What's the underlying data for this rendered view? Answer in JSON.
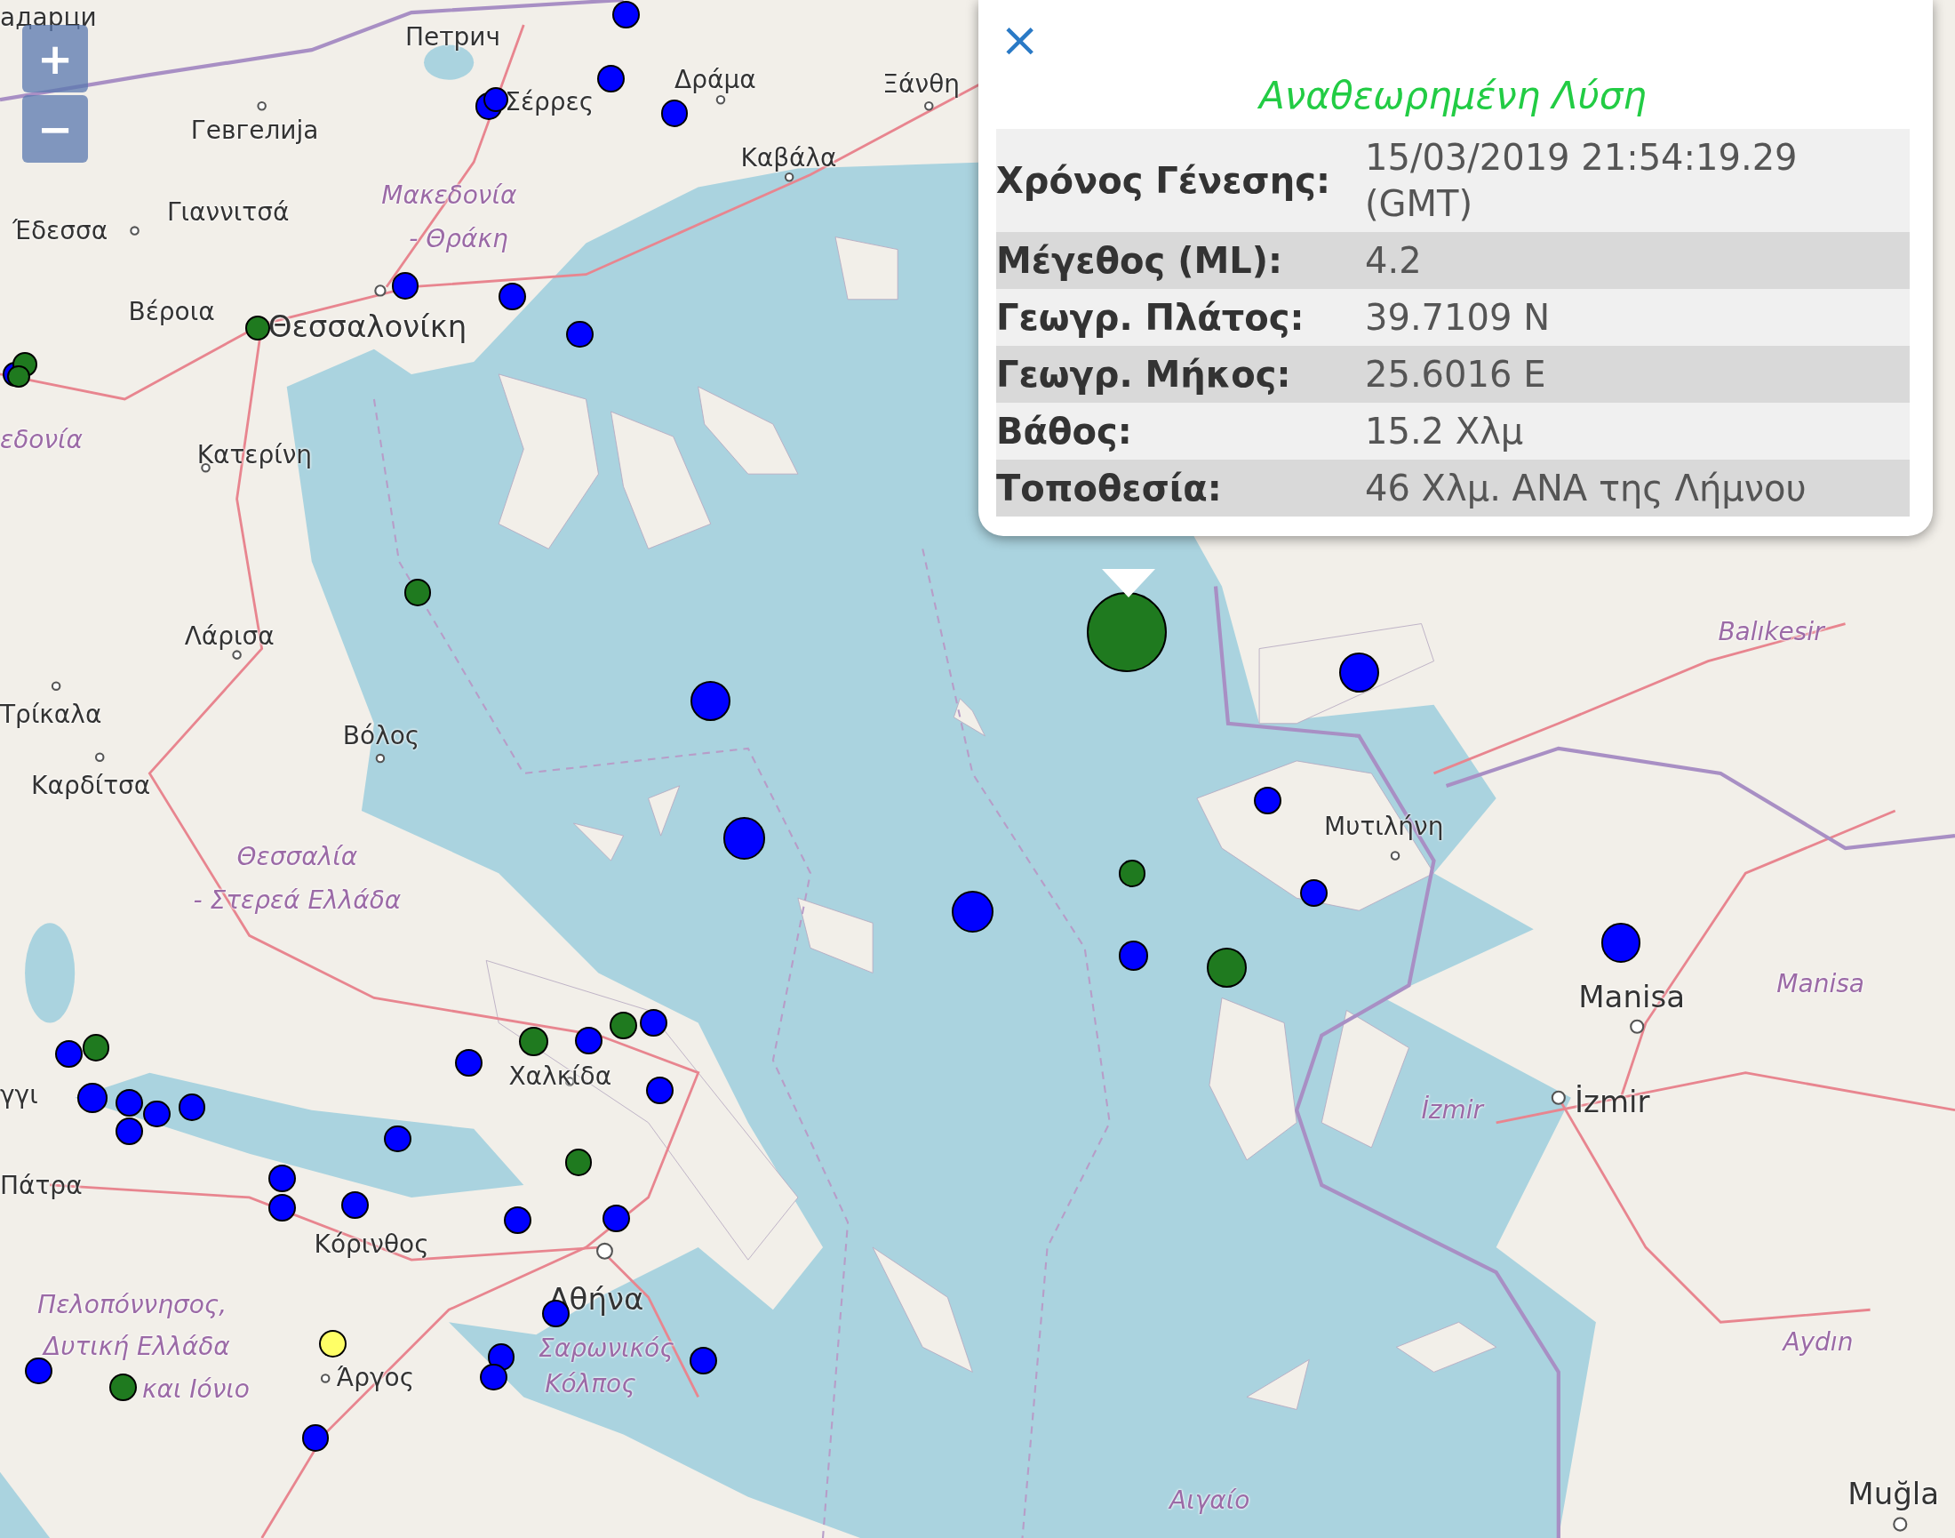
{
  "zoom_controls": [
    {
      "label": "+"
    },
    {
      "label": "−"
    }
  ],
  "map": {
    "labels": [
      {
        "text": "адарци",
        "kind": "city"
      },
      {
        "text": "Петрич",
        "kind": "city"
      },
      {
        "text": "Σέρρες",
        "kind": "city"
      },
      {
        "text": "Δράμα",
        "kind": "city"
      },
      {
        "text": "Ξάνθη",
        "kind": "city"
      },
      {
        "text": "Гевгелија",
        "kind": "city"
      },
      {
        "text": "Καβάλα",
        "kind": "city"
      },
      {
        "text": "Γιαννιτσά",
        "kind": "city"
      },
      {
        "text": "Μακεδονία",
        "kind": "region"
      },
      {
        "text": "- Θράκη",
        "kind": "region"
      },
      {
        "text": "Έδεσσα",
        "kind": "city"
      },
      {
        "text": "Βέροια",
        "kind": "city"
      },
      {
        "text": "Θεσσαλονίκη",
        "kind": "major"
      },
      {
        "text": "εδονία",
        "kind": "region"
      },
      {
        "text": "Κατερίνη",
        "kind": "city"
      },
      {
        "text": "Λάρισα",
        "kind": "city"
      },
      {
        "text": "Τρίκαλα",
        "kind": "city"
      },
      {
        "text": "Βόλος",
        "kind": "city"
      },
      {
        "text": "Καρδίτσα",
        "kind": "city"
      },
      {
        "text": "Θεσσαλία",
        "kind": "region"
      },
      {
        "text": "- Στερεά Ελλάδα",
        "kind": "region"
      },
      {
        "text": "Μυτιλήνη",
        "kind": "city"
      },
      {
        "text": "Balıkesir",
        "kind": "region"
      },
      {
        "text": "Manisa",
        "kind": "major"
      },
      {
        "text": "Manisa",
        "kind": "region"
      },
      {
        "text": "İzmir",
        "kind": "region"
      },
      {
        "text": "İzmir",
        "kind": "major"
      },
      {
        "text": "Aydın",
        "kind": "region"
      },
      {
        "text": "Muğla",
        "kind": "major"
      },
      {
        "text": "Αιγαίο",
        "kind": "region"
      },
      {
        "text": "γγι",
        "kind": "city"
      },
      {
        "text": "Χαλκίδα",
        "kind": "city"
      },
      {
        "text": "Πάτρα",
        "kind": "city"
      },
      {
        "text": "Κόρινθος",
        "kind": "city"
      },
      {
        "text": "Αθήνα",
        "kind": "major"
      },
      {
        "text": "Σαρωνικός",
        "kind": "region"
      },
      {
        "text": "Κόλπος",
        "kind": "region"
      },
      {
        "text": "Πελοπόννησος,",
        "kind": "region"
      },
      {
        "text": "Δυτική Ελλάδα",
        "kind": "region"
      },
      {
        "text": "και Ιόνιο",
        "kind": "region"
      },
      {
        "text": "Άργος",
        "kind": "city"
      }
    ],
    "markers": [
      {
        "color": "#0000ff"
      },
      {
        "color": "#0000ff"
      },
      {
        "color": "#0000ff"
      },
      {
        "color": "#0000ff"
      },
      {
        "color": "#0000ff"
      },
      {
        "color": "#0000ff"
      },
      {
        "color": "#0000ff"
      },
      {
        "color": "#0000ff"
      },
      {
        "color": "#1f7a1f"
      },
      {
        "color": "#0000ff"
      },
      {
        "color": "#1f7a1f"
      },
      {
        "color": "#1f7a1f"
      },
      {
        "color": "#1f7a1f"
      },
      {
        "color": "#0000ff"
      },
      {
        "color": "#0000ff"
      },
      {
        "color": "#0000ff"
      },
      {
        "color": "#1f7a1f"
      },
      {
        "color": "#0000ff"
      },
      {
        "color": "#1f7a1f"
      },
      {
        "color": "#0000ff"
      },
      {
        "color": "#0000ff"
      },
      {
        "color": "#0000ff"
      },
      {
        "color": "#0000ff"
      },
      {
        "color": "#1f7a1f"
      },
      {
        "color": "#0000ff"
      },
      {
        "color": "#1f7a1f"
      },
      {
        "color": "#0000ff"
      },
      {
        "color": "#0000ff"
      },
      {
        "color": "#0000ff"
      },
      {
        "color": "#0000ff"
      },
      {
        "color": "#0000ff"
      },
      {
        "color": "#0000ff"
      },
      {
        "color": "#0000ff"
      },
      {
        "color": "#1f7a1f"
      },
      {
        "color": "#0000ff"
      },
      {
        "color": "#1f7a1f"
      },
      {
        "color": "#0000ff"
      },
      {
        "color": "#0000ff"
      },
      {
        "color": "#0000ff"
      },
      {
        "color": "#1f7a1f"
      },
      {
        "color": "#0000ff"
      },
      {
        "color": "#0000ff"
      },
      {
        "color": "#0000ff"
      },
      {
        "color": "#0000ff"
      },
      {
        "color": "#0000ff"
      },
      {
        "color": "#0000ff"
      },
      {
        "color": "#0000ff"
      },
      {
        "color": "#0000ff"
      },
      {
        "color": "#ffff66"
      },
      {
        "color": "#0000ff"
      },
      {
        "color": "#1f7a1f"
      },
      {
        "color": "#0000ff"
      }
    ]
  },
  "popup": {
    "close": "×",
    "title": "Αναθεωρημένη Λύση",
    "rows": [
      {
        "label": "Χρόνος Γένεσης:",
        "value": "15/03/2019 21:54:19.29 (GMT)"
      },
      {
        "label": "Μέγεθος (ML):",
        "value": "4.2"
      },
      {
        "label": "Γεωγρ. Πλάτος:",
        "value": "39.7109 N"
      },
      {
        "label": "Γεωγρ. Μήκος:",
        "value": "25.6016 E"
      },
      {
        "label": "Βάθος:",
        "value": "15.2 Χλμ"
      },
      {
        "label": "Τοποθεσία:",
        "value": "46 Χλμ. ΑΝΑ της Λήμνου"
      }
    ]
  }
}
